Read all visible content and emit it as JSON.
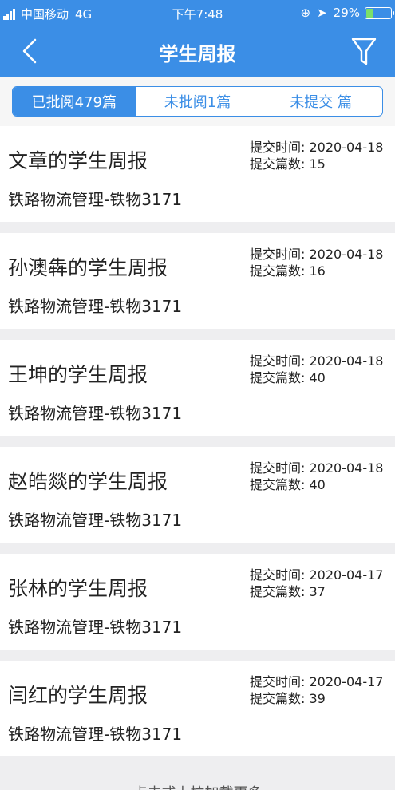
{
  "status": {
    "carrier": "中国移动",
    "network": "4G",
    "time": "下午7:48",
    "battery_text": "29%",
    "battery_level": 0.29,
    "battery_color": "#7be06a"
  },
  "nav": {
    "title": "学生周报",
    "bg_color": "#3b8ee6"
  },
  "tabs": [
    {
      "label": "已批阅479篇",
      "active": true
    },
    {
      "label": "未批阅1篇",
      "active": false
    },
    {
      "label": "未提交 篇",
      "active": false
    }
  ],
  "reports": [
    {
      "name": "文章的学生周报",
      "class": "铁路物流管理-铁物3171",
      "submit_time": "提交时间: 2020-04-18",
      "submit_count": "提交篇数: 15"
    },
    {
      "name": "孙澳犇的学生周报",
      "class": "铁路物流管理-铁物3171",
      "submit_time": "提交时间: 2020-04-18",
      "submit_count": "提交篇数: 16"
    },
    {
      "name": "王坤的学生周报",
      "class": "铁路物流管理-铁物3171",
      "submit_time": "提交时间: 2020-04-18",
      "submit_count": "提交篇数: 40"
    },
    {
      "name": "赵皓燚的学生周报",
      "class": "铁路物流管理-铁物3171",
      "submit_time": "提交时间: 2020-04-18",
      "submit_count": "提交篇数: 40"
    },
    {
      "name": "张林的学生周报",
      "class": "铁路物流管理-铁物3171",
      "submit_time": "提交时间: 2020-04-17",
      "submit_count": "提交篇数: 37"
    },
    {
      "name": "闫红的学生周报",
      "class": "铁路物流管理-铁物3171",
      "submit_time": "提交时间: 2020-04-17",
      "submit_count": "提交篇数: 39"
    }
  ],
  "load_more": "点击或上拉加载更多"
}
